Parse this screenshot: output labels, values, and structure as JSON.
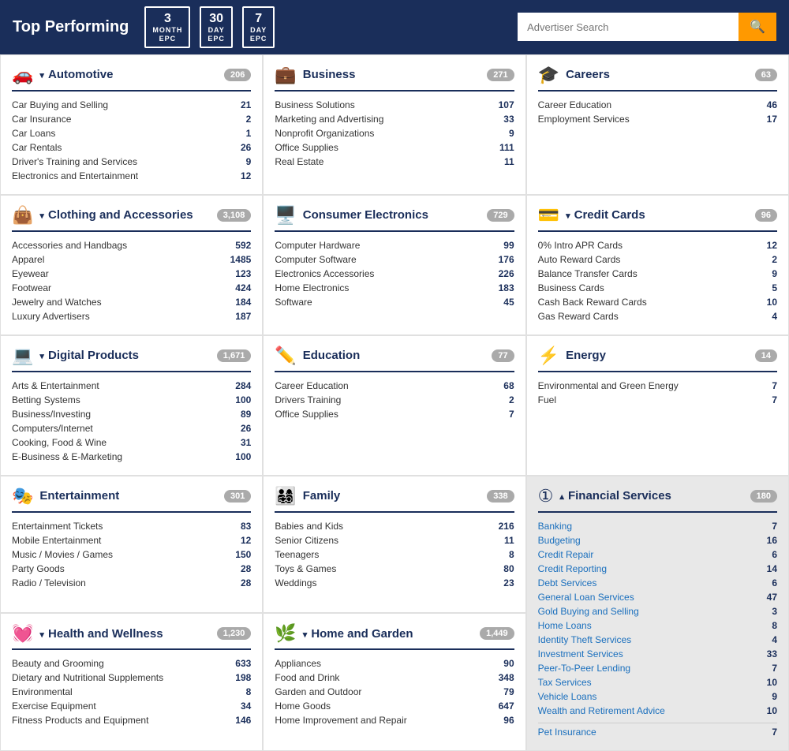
{
  "header": {
    "title": "Top Performing",
    "epc_buttons": [
      {
        "big": "3",
        "small": "MONTH\nEPC"
      },
      {
        "big": "30",
        "small": "DAY\nEPC"
      },
      {
        "big": "7",
        "small": "DAY\nEPC"
      }
    ],
    "search_placeholder": "Advertiser Search"
  },
  "cards": [
    {
      "id": "automotive",
      "icon": "🚗",
      "title": "Automotive",
      "count": "206",
      "collapsed": false,
      "chevron": "▾",
      "rows": [
        {
          "label": "Car Buying and Selling",
          "num": "21"
        },
        {
          "label": "Car Insurance",
          "num": "2"
        },
        {
          "label": "Car Loans",
          "num": "1"
        },
        {
          "label": "Car Rentals",
          "num": "26"
        },
        {
          "label": "Driver's Training and Services",
          "num": "9"
        },
        {
          "label": "Electronics and Entertainment",
          "num": "12"
        }
      ]
    },
    {
      "id": "business",
      "icon": "💼",
      "title": "Business",
      "count": "271",
      "collapsed": false,
      "chevron": "",
      "rows": [
        {
          "label": "Business Solutions",
          "num": "107"
        },
        {
          "label": "Marketing and Advertising",
          "num": "33"
        },
        {
          "label": "Nonprofit Organizations",
          "num": "9"
        },
        {
          "label": "Office Supplies",
          "num": "111"
        },
        {
          "label": "Real Estate",
          "num": "11"
        }
      ]
    },
    {
      "id": "careers",
      "icon": "🎓",
      "title": "Careers",
      "count": "63",
      "collapsed": false,
      "chevron": "",
      "rows": [
        {
          "label": "Career Education",
          "num": "46"
        },
        {
          "label": "Employment Services",
          "num": "17"
        }
      ]
    },
    {
      "id": "clothing",
      "icon": "👜",
      "title": "Clothing and Accessories",
      "count": "3,108",
      "collapsed": false,
      "chevron": "▾",
      "rows": [
        {
          "label": "Accessories and Handbags",
          "num": "592"
        },
        {
          "label": "Apparel",
          "num": "1485"
        },
        {
          "label": "Eyewear",
          "num": "123"
        },
        {
          "label": "Footwear",
          "num": "424"
        },
        {
          "label": "Jewelry and Watches",
          "num": "184"
        },
        {
          "label": "Luxury Advertisers",
          "num": "187"
        }
      ]
    },
    {
      "id": "consumer-electronics",
      "icon": "🖥️",
      "title": "Consumer Electronics",
      "count": "729",
      "collapsed": false,
      "chevron": "",
      "rows": [
        {
          "label": "Computer Hardware",
          "num": "99"
        },
        {
          "label": "Computer Software",
          "num": "176"
        },
        {
          "label": "Electronics Accessories",
          "num": "226"
        },
        {
          "label": "Home Electronics",
          "num": "183"
        },
        {
          "label": "Software",
          "num": "45"
        }
      ]
    },
    {
      "id": "credit-cards",
      "icon": "💳",
      "title": "Credit Cards",
      "count": "96",
      "collapsed": false,
      "chevron": "▾",
      "rows": [
        {
          "label": "0% Intro APR Cards",
          "num": "12"
        },
        {
          "label": "Auto Reward Cards",
          "num": "2"
        },
        {
          "label": "Balance Transfer Cards",
          "num": "9"
        },
        {
          "label": "Business Cards",
          "num": "5"
        },
        {
          "label": "Cash Back Reward Cards",
          "num": "10"
        },
        {
          "label": "Gas Reward Cards",
          "num": "4"
        }
      ]
    },
    {
      "id": "digital-products",
      "icon": "💻",
      "title": "Digital Products",
      "count": "1,671",
      "collapsed": false,
      "chevron": "▾",
      "rows": [
        {
          "label": "Arts & Entertainment",
          "num": "284"
        },
        {
          "label": "Betting Systems",
          "num": "100"
        },
        {
          "label": "Business/Investing",
          "num": "89"
        },
        {
          "label": "Computers/Internet",
          "num": "26"
        },
        {
          "label": "Cooking, Food & Wine",
          "num": "31"
        },
        {
          "label": "E-Business & E-Marketing",
          "num": "100"
        }
      ]
    },
    {
      "id": "education",
      "icon": "✏️",
      "title": "Education",
      "count": "77",
      "collapsed": false,
      "chevron": "",
      "rows": [
        {
          "label": "Career Education",
          "num": "68"
        },
        {
          "label": "Drivers Training",
          "num": "2"
        },
        {
          "label": "Office Supplies",
          "num": "7"
        }
      ]
    },
    {
      "id": "energy",
      "icon": "⚡",
      "title": "Energy",
      "count": "14",
      "collapsed": false,
      "chevron": "",
      "rows": [
        {
          "label": "Environmental and Green Energy",
          "num": "7"
        },
        {
          "label": "Fuel",
          "num": "7"
        }
      ]
    },
    {
      "id": "entertainment",
      "icon": "🎭",
      "title": "Entertainment",
      "count": "301",
      "collapsed": false,
      "chevron": "",
      "rows": [
        {
          "label": "Entertainment Tickets",
          "num": "83"
        },
        {
          "label": "Mobile Entertainment",
          "num": "12"
        },
        {
          "label": "Music / Movies / Games",
          "num": "150"
        },
        {
          "label": "Party Goods",
          "num": "28"
        },
        {
          "label": "Radio / Television",
          "num": "28"
        }
      ]
    },
    {
      "id": "family",
      "icon": "👨‍👩‍👧‍👦",
      "title": "Family",
      "count": "338",
      "collapsed": false,
      "chevron": "",
      "rows": [
        {
          "label": "Babies and Kids",
          "num": "216"
        },
        {
          "label": "Senior Citizens",
          "num": "11"
        },
        {
          "label": "Teenagers",
          "num": "8"
        },
        {
          "label": "Toys & Games",
          "num": "80"
        },
        {
          "label": "Weddings",
          "num": "23"
        }
      ]
    },
    {
      "id": "financial-services",
      "icon": "①",
      "title": "Financial Services",
      "count": "180",
      "collapsed": false,
      "chevron": "▴",
      "special": true,
      "rows": [
        {
          "label": "Banking",
          "num": "7"
        },
        {
          "label": "Budgeting",
          "num": "16"
        },
        {
          "label": "Credit Repair",
          "num": "6"
        },
        {
          "label": "Credit Reporting",
          "num": "14"
        },
        {
          "label": "Debt Services",
          "num": "6"
        },
        {
          "label": "General Loan Services",
          "num": "47"
        },
        {
          "label": "Gold Buying and Selling",
          "num": "3"
        },
        {
          "label": "Home Loans",
          "num": "8"
        },
        {
          "label": "Identity Theft Services",
          "num": "4"
        },
        {
          "label": "Investment Services",
          "num": "33"
        },
        {
          "label": "Peer-To-Peer Lending",
          "num": "7"
        },
        {
          "label": "Tax Services",
          "num": "10"
        },
        {
          "label": "Vehicle Loans",
          "num": "9"
        },
        {
          "label": "Wealth and Retirement Advice",
          "num": "10"
        }
      ]
    },
    {
      "id": "health-wellness",
      "icon": "💓",
      "title": "Health and Wellness",
      "count": "1,230",
      "collapsed": false,
      "chevron": "▾",
      "rows": [
        {
          "label": "Beauty and Grooming",
          "num": "633"
        },
        {
          "label": "Dietary and Nutritional Supplements",
          "num": "198"
        },
        {
          "label": "Environmental",
          "num": "8"
        },
        {
          "label": "Exercise Equipment",
          "num": "34"
        },
        {
          "label": "Fitness Products and Equipment",
          "num": "146"
        }
      ]
    },
    {
      "id": "home-garden",
      "icon": "🌿",
      "title": "Home and Garden",
      "count": "1,449",
      "collapsed": false,
      "chevron": "▾",
      "rows": [
        {
          "label": "Appliances",
          "num": "90"
        },
        {
          "label": "Food and Drink",
          "num": "348"
        },
        {
          "label": "Garden and Outdoor",
          "num": "79"
        },
        {
          "label": "Home Goods",
          "num": "647"
        },
        {
          "label": "Home Improvement and Repair",
          "num": "96"
        }
      ]
    },
    {
      "id": "pet-insurance",
      "icon": "🐾",
      "title": "Pet Insurance",
      "count": "",
      "collapsed": false,
      "chevron": "",
      "special_row": true,
      "rows": [
        {
          "label": "Pet Insurance",
          "num": "7"
        }
      ]
    }
  ]
}
